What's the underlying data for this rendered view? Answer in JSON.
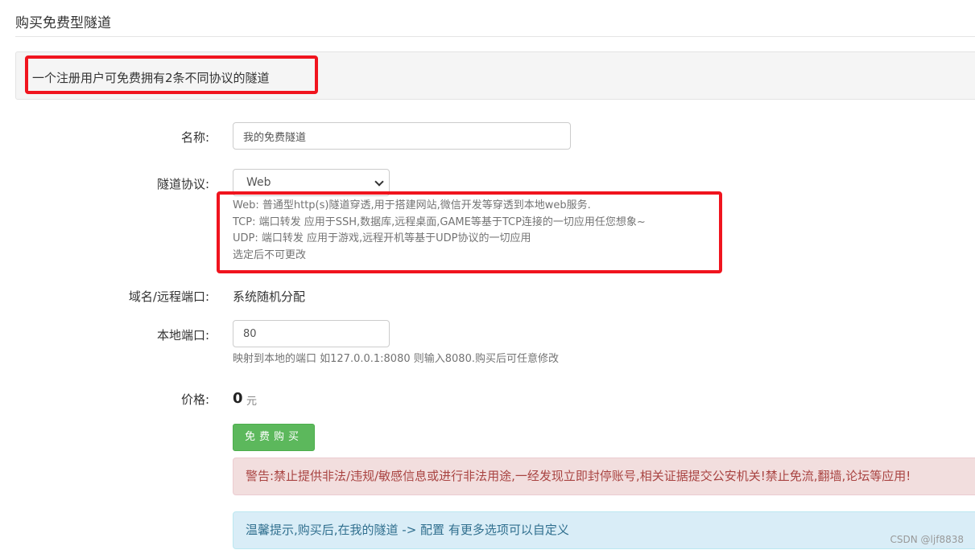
{
  "page": {
    "title": "购买免费型隧道",
    "notice": "一个注册用户可免费拥有2条不同协议的隧道"
  },
  "form": {
    "name": {
      "label": "名称:",
      "value": "我的免费隧道"
    },
    "protocol": {
      "label": "隧道协议:",
      "selected": "Web",
      "help": [
        "Web: 普通型http(s)隧道穿透,用于搭建网站,微信开发等穿透到本地web服务.",
        "TCP: 端口转发 应用于SSH,数据库,远程桌面,GAME等基于TCP连接的一切应用任您想象~",
        "UDP: 端口转发 应用于游戏,远程开机等基于UDP协议的一切应用",
        "选定后不可更改"
      ]
    },
    "domain": {
      "label": "域名/远程端口:",
      "value": "系统随机分配"
    },
    "local_port": {
      "label": "本地端口:",
      "value": "80",
      "help": "映射到本地的端口 如127.0.0.1:8080 则输入8080.购买后可任意修改"
    },
    "price": {
      "label": "价格:",
      "amount": "0",
      "unit": "元"
    },
    "buy_button": "免费购买"
  },
  "alerts": {
    "warning": "警告:禁止提供非法/违规/敏感信息或进行非法用途,一经发现立即封停账号,相关证据提交公安机关!禁止免流,翻墙,论坛等应用!",
    "tip": "温馨提示,购买后,在我的隧道 -> 配置 有更多选项可以自定义"
  },
  "watermark": "CSDN @ljf8838",
  "colors": {
    "annotation": "#f0141e",
    "success": "#5cb85c",
    "danger_bg": "#f2dede",
    "info_bg": "#d9edf7"
  }
}
